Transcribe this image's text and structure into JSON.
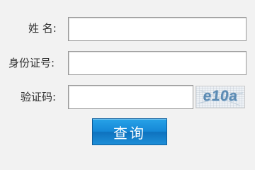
{
  "form": {
    "name_label": "姓 名:",
    "id_label": "身份证号:",
    "captcha_label": "验证码:",
    "name_value": "",
    "id_value": "",
    "captcha_value": "",
    "captcha_image_text": "e10a",
    "submit_label": "查询"
  },
  "colors": {
    "background": "#f2f2f2",
    "button": "#1588d6",
    "captcha_text": "#5c8bb3"
  }
}
